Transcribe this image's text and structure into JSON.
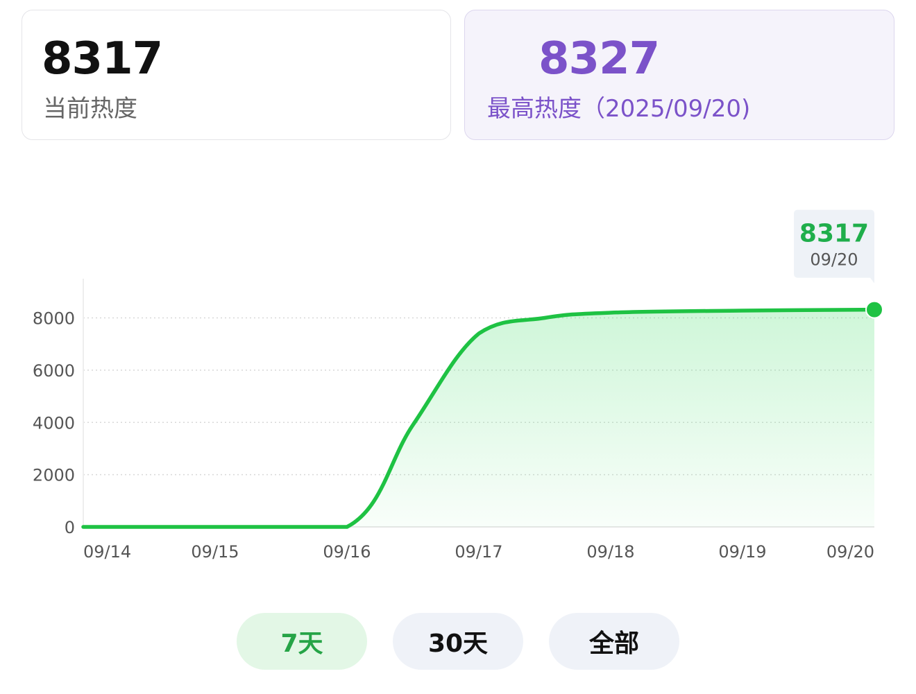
{
  "cards": {
    "current": {
      "value": "8317",
      "label": "当前热度"
    },
    "peak": {
      "value": "8327",
      "label": "最高热度（2025/09/20)"
    }
  },
  "colors": {
    "line": "#1ec243",
    "peak_accent": "#7b52c9",
    "active_button_bg": "#e3f7e6",
    "active_button_text": "#26a447"
  },
  "range_buttons": [
    {
      "label": "7天",
      "active": true
    },
    {
      "label": "30天",
      "active": false
    },
    {
      "label": "全部",
      "active": false
    }
  ],
  "chart_data": {
    "type": "area",
    "x": [
      "09/14",
      "09/15",
      "09/16",
      "09/17",
      "09/18",
      "09/19",
      "09/20"
    ],
    "y_ticks": [
      0,
      2000,
      4000,
      6000,
      8000
    ],
    "ylim": [
      0,
      9500
    ],
    "grid": true,
    "series": [
      {
        "points": [
          {
            "x": "09/14",
            "y": 0
          },
          {
            "x": "09/15",
            "y": 0
          },
          {
            "x": "09/16",
            "y": 0
          },
          {
            "x": "09/16 12:00",
            "y": 3900
          },
          {
            "x": "09/17",
            "y": 7400
          },
          {
            "x": "09/17 12:00",
            "y": 8000
          },
          {
            "x": "09/18",
            "y": 8200
          },
          {
            "x": "09/19",
            "y": 8280
          },
          {
            "x": "09/20",
            "y": 8317
          }
        ]
      }
    ],
    "highlight": {
      "x": "09/20",
      "value": "8317",
      "date": "09/20"
    }
  }
}
